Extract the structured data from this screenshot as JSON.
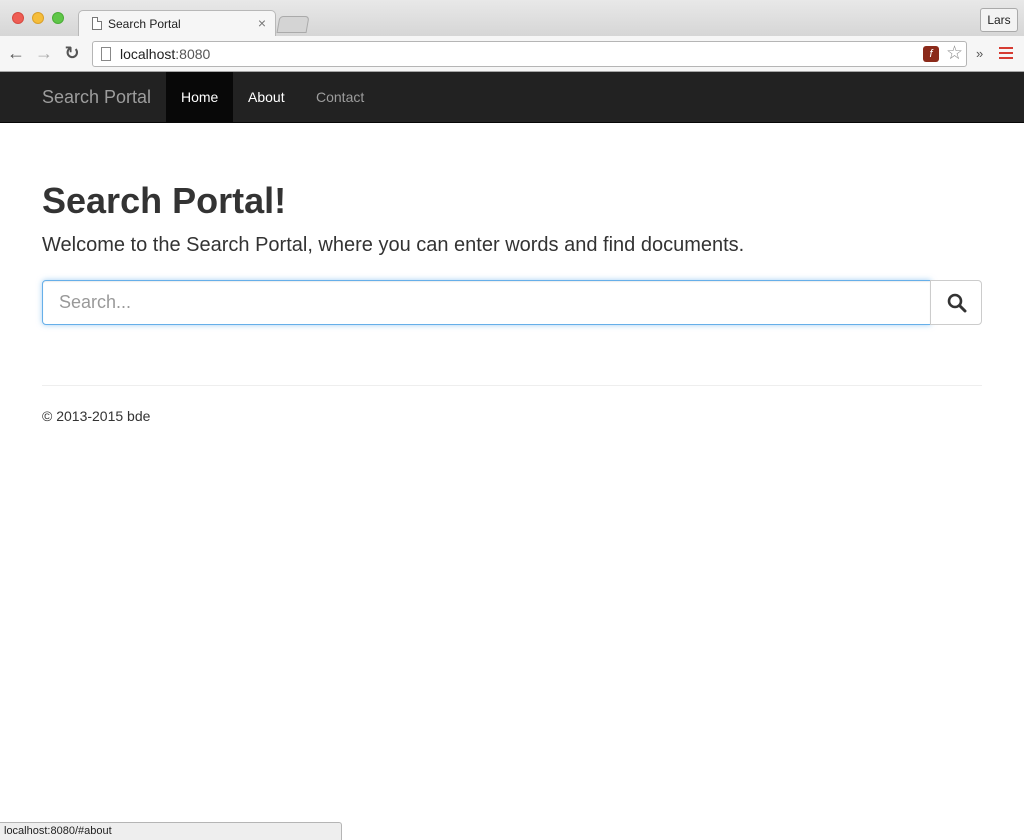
{
  "browser": {
    "tab_title": "Search Portal",
    "tab_close": "×",
    "profile_name": "Lars",
    "url_host": "localhost",
    "url_port": ":8080",
    "extensions_more": "»",
    "status_url": "localhost:8080/#about",
    "menu_color": "#d63b32"
  },
  "navbar": {
    "brand": "Search Portal",
    "items": [
      {
        "label": "Home",
        "active": true
      },
      {
        "label": "About",
        "active": false
      },
      {
        "label": "Contact",
        "active": false
      }
    ]
  },
  "main": {
    "title": "Search Portal!",
    "lead": "Welcome to the Search Portal, where you can enter words and find documents.",
    "search": {
      "placeholder": "Search...",
      "value": ""
    }
  },
  "footer": {
    "text": "© 2013-2015 bde"
  }
}
